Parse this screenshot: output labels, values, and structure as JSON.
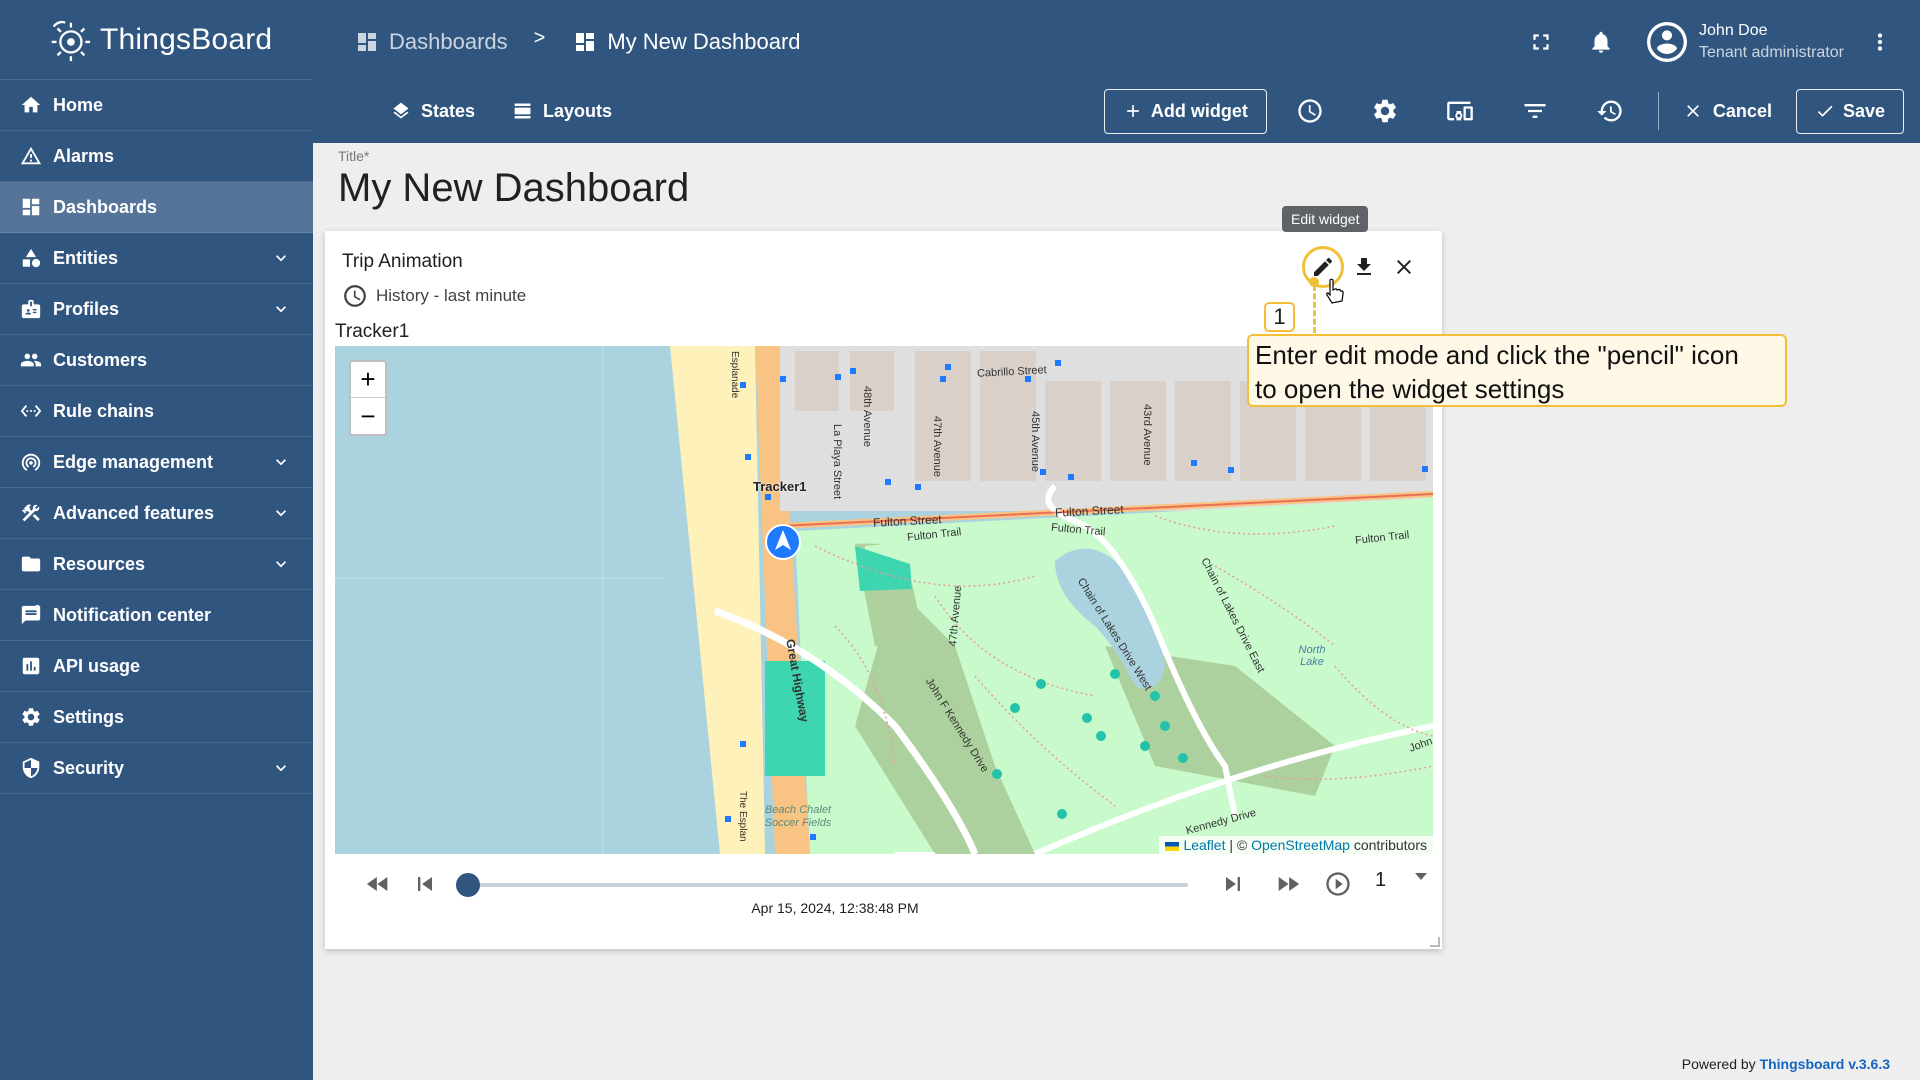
{
  "app": {
    "name": "ThingsBoard"
  },
  "sidebar": {
    "items": [
      {
        "label": "Home",
        "icon": "home-icon",
        "expandable": false
      },
      {
        "label": "Alarms",
        "icon": "warning-icon",
        "expandable": false
      },
      {
        "label": "Dashboards",
        "icon": "dashboard-icon",
        "expandable": false,
        "active": true
      },
      {
        "label": "Entities",
        "icon": "category-icon",
        "expandable": true
      },
      {
        "label": "Profiles",
        "icon": "badge-icon",
        "expandable": true
      },
      {
        "label": "Customers",
        "icon": "people-icon",
        "expandable": false
      },
      {
        "label": "Rule chains",
        "icon": "settings-ethernet-icon",
        "expandable": false
      },
      {
        "label": "Edge management",
        "icon": "router-icon",
        "expandable": true
      },
      {
        "label": "Advanced features",
        "icon": "construction-icon",
        "expandable": true
      },
      {
        "label": "Resources",
        "icon": "folder-icon",
        "expandable": true
      },
      {
        "label": "Notification center",
        "icon": "notification-icon",
        "expandable": false
      },
      {
        "label": "API usage",
        "icon": "insert-chart-icon",
        "expandable": false
      },
      {
        "label": "Settings",
        "icon": "gear-icon",
        "expandable": false
      },
      {
        "label": "Security",
        "icon": "shield-icon",
        "expandable": true
      }
    ]
  },
  "header": {
    "breadcrumb": {
      "parent": "Dashboards",
      "separator": ">",
      "current": "My New Dashboard"
    },
    "user": {
      "name": "John Doe",
      "role": "Tenant administrator"
    },
    "states_label": "States",
    "layouts_label": "Layouts",
    "add_widget_label": "Add widget",
    "cancel_label": "Cancel",
    "save_label": "Save"
  },
  "main": {
    "title_label": "Title*",
    "title": "My New Dashboard"
  },
  "widget": {
    "title": "Trip Animation",
    "timewindow": "History - last minute",
    "tracker_label": "Tracker1",
    "map": {
      "marker_label": "Tracker1",
      "zoom_in": "+",
      "zoom_out": "−",
      "streets": [
        "Cabrillo Street",
        "Fulton Street",
        "Fulton Trail",
        "Fulton Trail",
        "48th Avenue",
        "47th Avenue",
        "45th Avenue",
        "43rd Avenue",
        "La Playa Street",
        "Great Highway",
        "John F Kennedy Drive",
        "Chain of Lakes Drive West",
        "Chain of Lakes Drive East",
        "Kennedy Drive",
        "47th Avenue",
        "Beach Chalet Soccer Fields",
        "North Lake",
        "Esplanade",
        "The Esplan",
        "John"
      ],
      "attribution": {
        "leaflet": "Leaflet",
        "sep": " | © ",
        "osm": "OpenStreetMap",
        "suffix": " contributors"
      }
    },
    "player": {
      "timestamp": "Apr 15, 2024, 12:38:48 PM",
      "speed": "1",
      "progress": 0
    }
  },
  "overlay": {
    "tooltip": "Edit widget",
    "step_number": "1",
    "callout_line1": "Enter edit mode and click the \"pencil\" icon",
    "callout_line2": "to open the widget settings"
  },
  "footer": {
    "powered_by": "Powered by ",
    "version_link": "Thingsboard v.3.6.3"
  },
  "colors": {
    "primary": "#305680",
    "highlight": "#f2c037",
    "map_water": "#aad3df",
    "park": "#c8facc"
  }
}
